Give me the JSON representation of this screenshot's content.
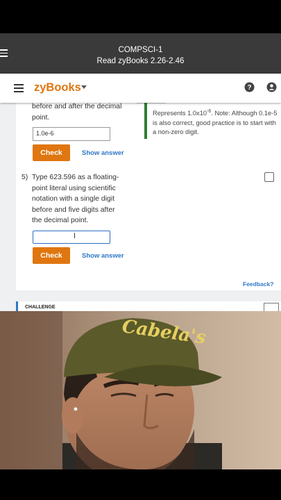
{
  "header": {
    "course": "COMPSCI-1",
    "assignment": "Read zyBooks 2.26-2.46"
  },
  "zybooks": {
    "brand": "zyBooks"
  },
  "question4": {
    "text_tail": "before and after the decimal point.",
    "answer_value": "1.0e-6",
    "check_label": "Check",
    "show_answer_label": "Show answer",
    "explanation": "Represents 1.0x10-6. Note: Although 0.1e-5 is also correct, good practice is to start with a non-zero digit."
  },
  "question5": {
    "number": "5)",
    "text": "Type 623.596 as a floating-point literal using scientific notation with a single digit before and five digits after the decimal point.",
    "answer_value": "",
    "check_label": "Check",
    "show_answer_label": "Show answer"
  },
  "feedback_label": "Feedback?",
  "challenge": {
    "label": "CHALLENGE"
  },
  "video": {
    "cap_text": "Cabela's"
  },
  "colors": {
    "accent_orange": "#e0760f",
    "link_blue": "#2f78c8",
    "explanation_green": "#2e7d32",
    "header_gray": "#3a3a3a"
  }
}
